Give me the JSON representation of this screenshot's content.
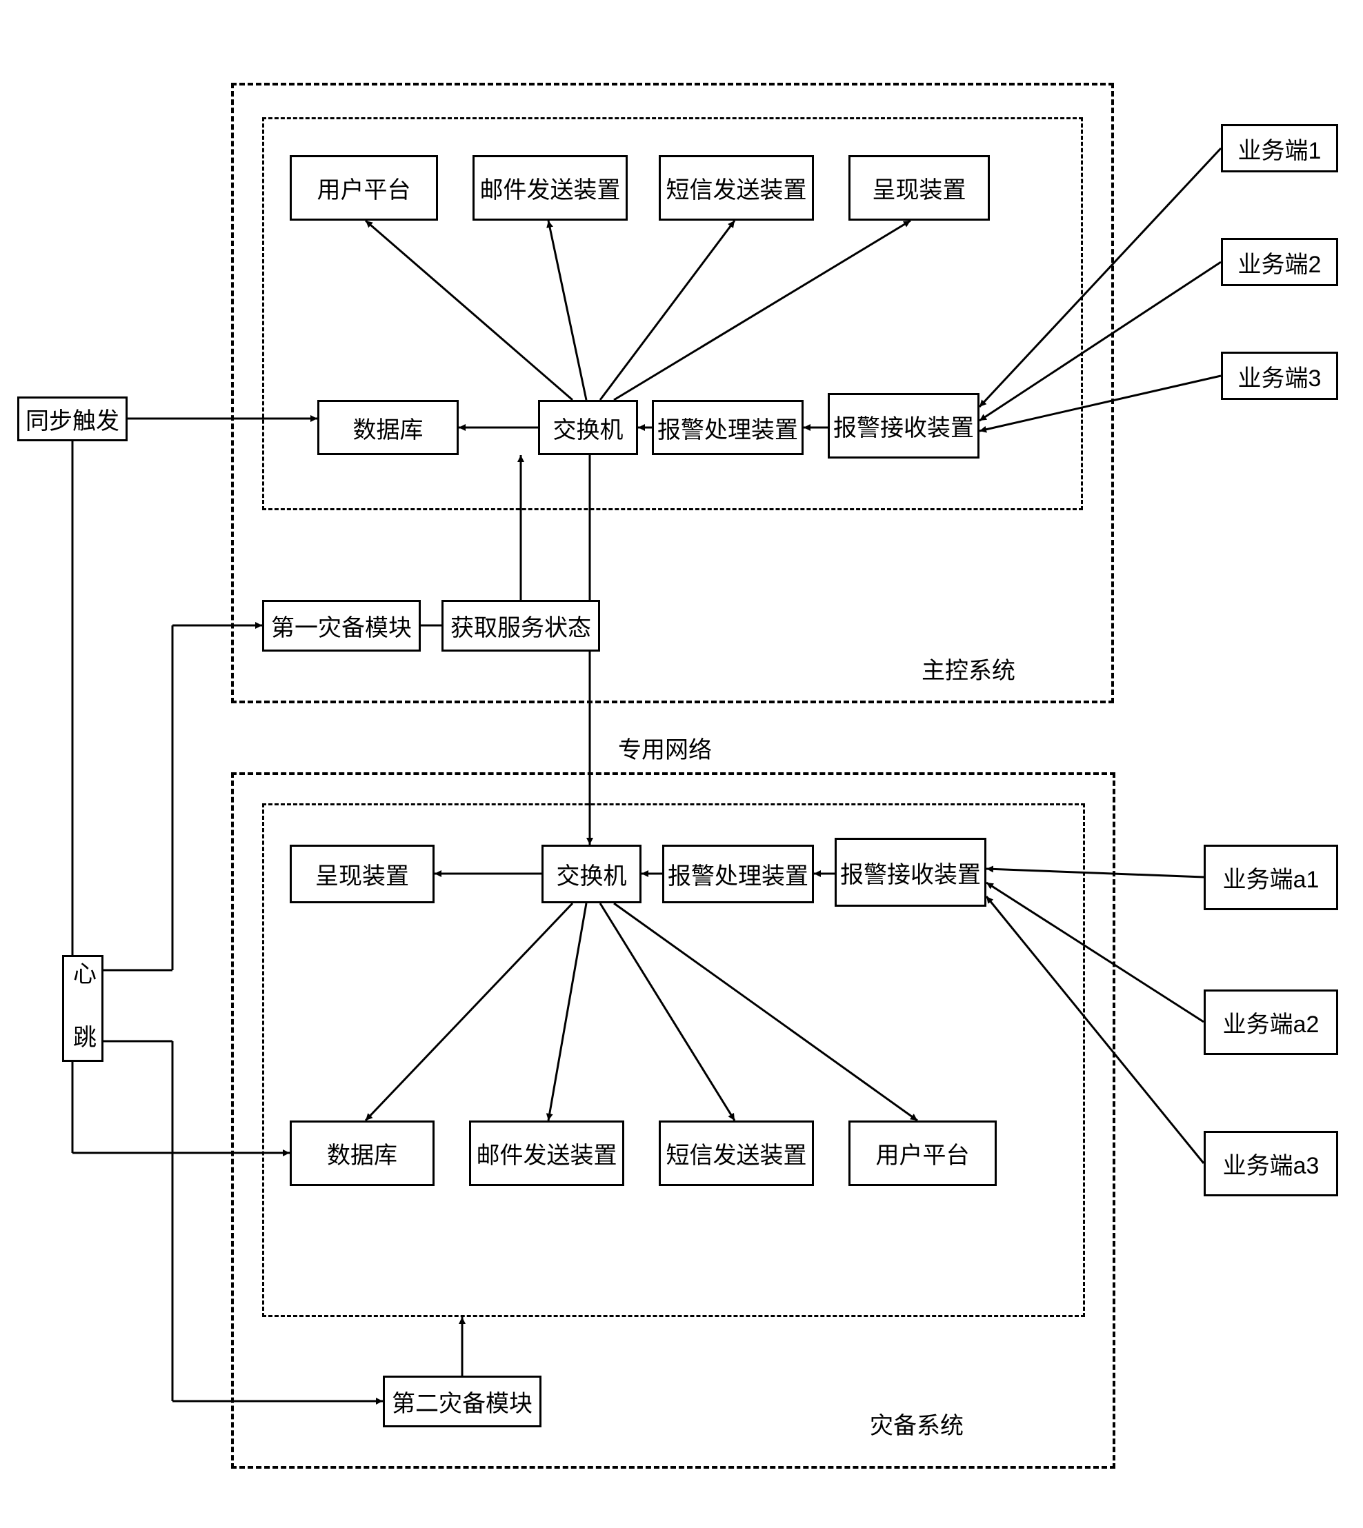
{
  "left": {
    "sync_trigger": "同步触发",
    "heartbeat": "心　跳"
  },
  "main": {
    "outer_label": "主控系统",
    "user_platform": "用户平台",
    "mail_sender": "邮件发送装置",
    "sms_sender": "短信发送装置",
    "presenter": "呈现装置",
    "database": "数据库",
    "switch": "交换机",
    "alarm_handler": "报警处理装置",
    "alarm_receiver": "报警接收装置",
    "dr_module1": "第一灾备模块",
    "get_status": "获取服务状态"
  },
  "mid": {
    "private_net": "专用网络"
  },
  "backup": {
    "outer_label": "灾备系统",
    "presenter": "呈现装置",
    "switch": "交换机",
    "alarm_handler": "报警处理装置",
    "alarm_receiver": "报警接收装置",
    "database": "数据库",
    "mail_sender": "邮件发送装置",
    "sms_sender": "短信发送装置",
    "user_platform": "用户平台",
    "dr_module2": "第二灾备模块"
  },
  "biz_main": {
    "b1": "业务端1",
    "b2": "业务端2",
    "b3": "业务端3"
  },
  "biz_backup": {
    "a1": "业务端a1",
    "a2": "业务端a2",
    "a3": "业务端a3"
  }
}
